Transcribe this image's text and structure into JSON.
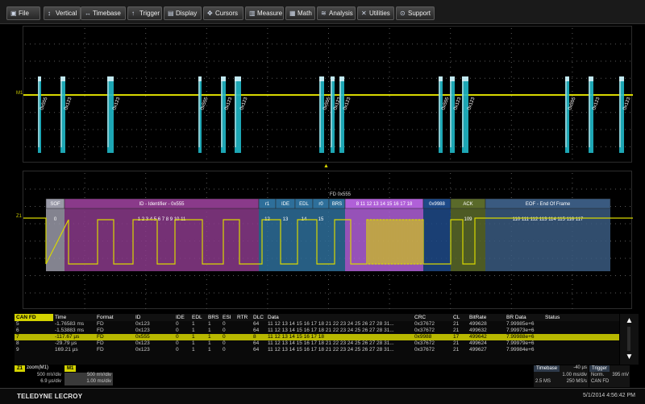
{
  "menu": [
    {
      "label": "File",
      "icon": "folder-icon"
    },
    {
      "label": "Vertical",
      "icon": "vertical-icon"
    },
    {
      "label": "Timebase",
      "icon": "timebase-icon"
    },
    {
      "label": "Trigger",
      "icon": "trigger-icon"
    },
    {
      "label": "Display",
      "icon": "display-icon"
    },
    {
      "label": "Cursors",
      "icon": "cursors-icon"
    },
    {
      "label": "Measure",
      "icon": "measure-icon"
    },
    {
      "label": "Math",
      "icon": "math-icon"
    },
    {
      "label": "Analysis",
      "icon": "analysis-icon"
    },
    {
      "label": "Utilities",
      "icon": "utilities-icon"
    },
    {
      "label": "Support",
      "icon": "support-icon"
    }
  ],
  "top_trace": {
    "label": "M1",
    "packet_labels": [
      "0x555",
      "0x123",
      "0x123",
      "0x555",
      "0x123",
      "0x123",
      "0x555",
      "0x123",
      "0x123",
      "0x555",
      "0x123",
      "0x123",
      "0x555",
      "0x123",
      "0x123"
    ]
  },
  "zoom_trace": {
    "label": "Z1",
    "frame_title": "FD 0x555",
    "fields": [
      {
        "name": "SOF",
        "value": "0"
      },
      {
        "name": "ID - Identifier - 0x555",
        "value": "1 2 3 4 5 6 7 8 9 10 11"
      },
      {
        "name": "r1",
        "value": "12"
      },
      {
        "name": "IDE",
        "value": "13"
      },
      {
        "name": "EDL",
        "value": "14"
      },
      {
        "name": "r0",
        "value": "15"
      },
      {
        "name": "BRS",
        "value": ""
      },
      {
        "name": "8 11 12 13 14 15 16 17 18",
        "value": ""
      },
      {
        "name": "0x9988",
        "value": ""
      },
      {
        "name": "ACK",
        "value": "109"
      },
      {
        "name": "EOF - End Of Frame",
        "value": "110 111 112 113 114 115 116 117"
      }
    ]
  },
  "table": {
    "columns": [
      "CAN FD",
      "Time",
      "Format",
      "ID",
      "IDE",
      "EDL",
      "BRS",
      "ESI",
      "RTR",
      "DLC",
      "Data",
      "CRC",
      "CL",
      "BitRate",
      "BR Data",
      "Status"
    ],
    "rows": [
      [
        "5",
        "-1.76583 ms",
        "FD",
        "0x123",
        "0",
        "1",
        "1",
        "0",
        "",
        "64",
        "11 12 13 14 15 16 17 18 21 22 23 24 25 26 27 28 31...",
        "0x37672",
        "21",
        "499628",
        "7.99985e+6",
        ""
      ],
      [
        "6",
        "-1.53883 ms",
        "FD",
        "0x123",
        "0",
        "1",
        "1",
        "0",
        "",
        "64",
        "11 12 13 14 15 16 17 18 21 22 23 24 25 26 27 28 31...",
        "0x37672",
        "21",
        "499632",
        "7.99973e+6",
        ""
      ],
      [
        "7",
        "-117.67 µs",
        "FD",
        "0x555",
        "0",
        "1",
        "1",
        "0",
        "",
        "8",
        "11 12 13 14 15 16 17 18",
        "0x9988",
        "17",
        "499642",
        "7.99988e+6",
        ""
      ],
      [
        "8",
        "-29.79 µs",
        "FD",
        "0x123",
        "0",
        "1",
        "1",
        "0",
        "",
        "64",
        "11 12 13 14 15 16 17 18 21 22 23 24 25 26 27 28 31...",
        "0x37672",
        "21",
        "499624",
        "7.99979e+6",
        ""
      ],
      [
        "9",
        "169.21 µs",
        "FD",
        "0x123",
        "0",
        "1",
        "1",
        "0",
        "",
        "64",
        "11 12 13 14 15 16 17 18 21 22 23 24 25 26 27 28 31...",
        "0x37672",
        "21",
        "499627",
        "7.99984e+6",
        ""
      ]
    ],
    "selected_row": 2
  },
  "descriptors": {
    "z1": {
      "tag": "Z1",
      "title": "zoom(M1)",
      "line1": "500 mV/div",
      "line2": "6.9 µs/div"
    },
    "m1": {
      "tag": "M1",
      "line1": "500 mV/div",
      "line2": "1.00 ms/div"
    },
    "timebase": {
      "title": "Timebase",
      "offset": "-40 µs",
      "line1": "1.00 ms/div",
      "line2a": "2.5 MS",
      "line2b": "250 MS/s"
    },
    "trigger": {
      "title": "Trigger",
      "mode": "Norm.",
      "level": "395 mV",
      "source": "CAN FD"
    }
  },
  "footer": {
    "brand": "TELEDYNE LECROY",
    "datetime": "5/1/2014 4:56:42 PM"
  },
  "colors": {
    "trace": "#d8d800",
    "packet": "#20b8c8",
    "sof": "#9a9aa8",
    "id_field": "#8a3a8a",
    "data_field": "#b060d8",
    "ack": "#5a6a2a",
    "eof": "#3a5a80"
  }
}
